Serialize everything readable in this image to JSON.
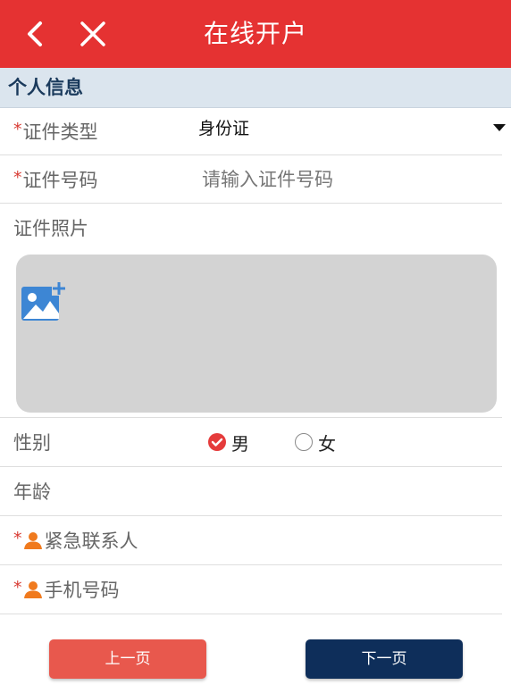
{
  "header": {
    "title": "在线开户",
    "background_color": "#e53232",
    "back_icon": "chevron-left-icon",
    "close_icon": "close-icon"
  },
  "section": {
    "title": "个人信息"
  },
  "form": {
    "required_mark": "*",
    "id_type": {
      "label": "证件类型",
      "value": "身份证"
    },
    "id_number": {
      "label": "证件号码",
      "placeholder": "请输入证件号码"
    },
    "id_photo": {
      "label": "证件照片",
      "icon": "add-image-icon"
    },
    "gender": {
      "label": "性别",
      "options": [
        {
          "label": "男",
          "checked": true
        },
        {
          "label": "女",
          "checked": false
        }
      ]
    },
    "age": {
      "label": "年龄"
    },
    "emergency_contact": {
      "label": "紧急联系人",
      "icon": "person-icon"
    },
    "phone": {
      "label": "手机号码",
      "icon": "person-icon"
    }
  },
  "buttons": {
    "prev_label": "上一页",
    "next_label": "下一页",
    "prev_color": "#e8584d",
    "next_color": "#0e2e5a"
  }
}
